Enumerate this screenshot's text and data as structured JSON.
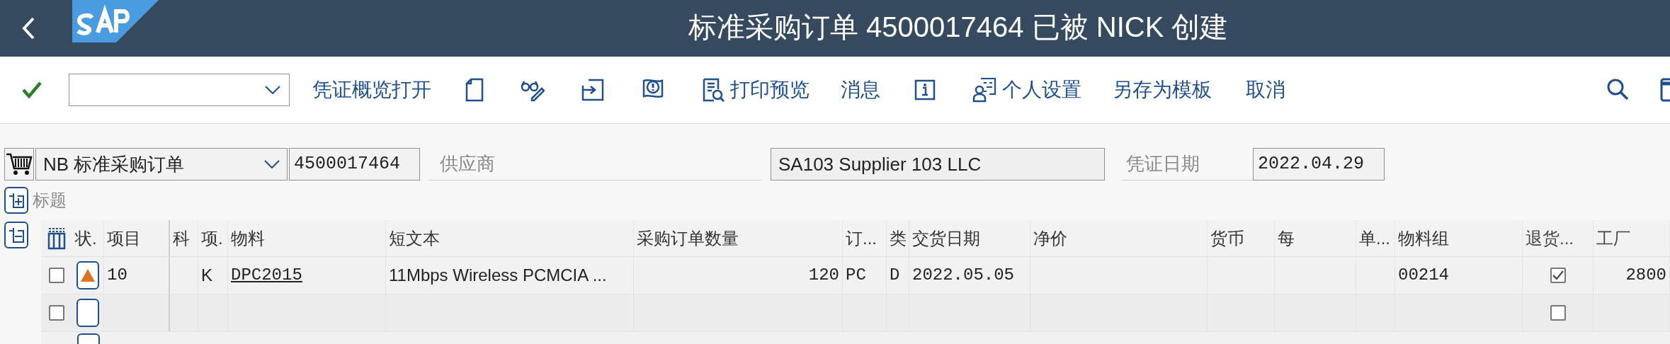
{
  "header": {
    "title": "标准采购订单 4500017464 已被 NICK 创建"
  },
  "toolbar": {
    "items": [
      {
        "kind": "check"
      },
      {
        "kind": "dropdown"
      },
      {
        "kind": "text",
        "label": "凭证概览打开"
      },
      {
        "kind": "icon"
      },
      {
        "kind": "icon"
      },
      {
        "kind": "icon"
      },
      {
        "kind": "icon"
      },
      {
        "kind": "icontext",
        "label": "打印预览"
      },
      {
        "kind": "text",
        "label": "消息"
      },
      {
        "kind": "icon"
      },
      {
        "kind": "icontext",
        "label": "个人设置"
      },
      {
        "kind": "text",
        "label": "另存为模板"
      },
      {
        "kind": "text",
        "label": "取消"
      }
    ]
  },
  "form": {
    "doc_type": "NB 标准采购订单",
    "order_number": "4500017464",
    "vendor_label": "供应商",
    "vendor": "SA103 Supplier 103 LLC",
    "date_label": "凭证日期",
    "date": "2022.04.29"
  },
  "section": {
    "label": "标题",
    "expanded": false
  },
  "table": {
    "columns": [
      "状.",
      "项目",
      "科",
      "项.",
      "物料",
      "短文本",
      "采购订单数量",
      "订...",
      "类",
      "交货日期",
      "净价",
      "货币",
      "每",
      "单...",
      "物料组",
      "退货...",
      "工厂"
    ],
    "rows": [
      {
        "selected": false,
        "warning": true,
        "item": "10",
        "account": "",
        "category": "K",
        "material": "DPC2015",
        "short_text": "11Mbps Wireless PCMCIA ...",
        "quantity": "120",
        "unit": "PC",
        "type": "D",
        "delivery_date": "2022.05.05",
        "net_price": "",
        "currency": "",
        "per": "",
        "order_unit": "",
        "material_group": "00214",
        "returns": true,
        "plant": "2800"
      },
      {
        "selected": false,
        "warning": false,
        "item": "",
        "account": "",
        "category": "",
        "material": "",
        "short_text": "",
        "quantity": "",
        "unit": "",
        "type": "",
        "delivery_date": "",
        "net_price": "",
        "currency": "",
        "per": "",
        "order_unit": "",
        "material_group": "",
        "returns": false,
        "plant": ""
      }
    ]
  }
}
